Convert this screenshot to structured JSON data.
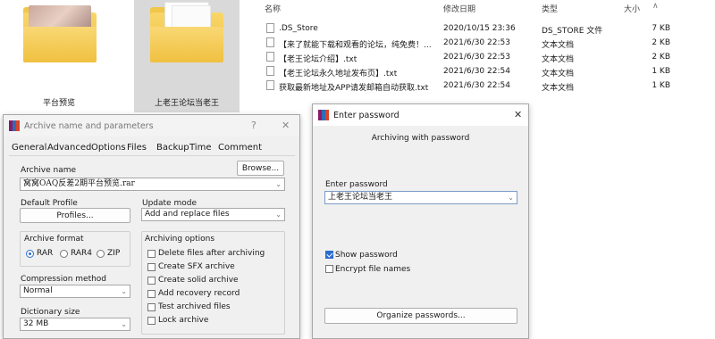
{
  "explorer": {
    "folders": [
      {
        "label": "平台预览"
      },
      {
        "label": "上老王论坛当老王"
      }
    ],
    "columns": {
      "name": "名称",
      "modified": "修改日期",
      "type": "类型",
      "size": "大小"
    },
    "files": [
      {
        "name": ".DS_Store",
        "modified": "2020/10/15 23:36",
        "type": "DS_STORE 文件",
        "size": "7 KB"
      },
      {
        "name": "【来了就能下载和观看的论坛，纯免费！...",
        "modified": "2021/6/30 22:53",
        "type": "文本文档",
        "size": "2 KB"
      },
      {
        "name": "【老王论坛介绍】.txt",
        "modified": "2021/6/30 22:53",
        "type": "文本文档",
        "size": "2 KB"
      },
      {
        "name": "【老王论坛永久地址发布页】.txt",
        "modified": "2021/6/30 22:54",
        "type": "文本文档",
        "size": "1 KB"
      },
      {
        "name": "获取最新地址及APP请发邮箱自动获取.txt",
        "modified": "2021/6/30 22:54",
        "type": "文本文档",
        "size": "1 KB"
      }
    ]
  },
  "archive_dialog": {
    "title": "Archive name and parameters",
    "help": "?",
    "close": "✕",
    "tabs": [
      "General",
      "Advanced",
      "Options",
      "Files",
      "Backup",
      "Time",
      "Comment"
    ],
    "archive_name_label": "Archive name",
    "browse_button": "Browse...",
    "archive_name_value": "窝窝OAQ反差2期平台预览.rar",
    "default_profile_label": "Default Profile",
    "profiles_button": "Profiles...",
    "update_mode_label": "Update mode",
    "update_mode_value": "Add and replace files",
    "archive_format_label": "Archive format",
    "formats": [
      "RAR",
      "RAR4",
      "ZIP"
    ],
    "compression_method_label": "Compression method",
    "compression_method_value": "Normal",
    "dictionary_size_label": "Dictionary size",
    "dictionary_size_value": "32 MB",
    "archiving_options_label": "Archiving options",
    "options": [
      "Delete files after archiving",
      "Create SFX archive",
      "Create solid archive",
      "Add recovery record",
      "Test archived files",
      "Lock archive"
    ]
  },
  "password_dialog": {
    "title": "Enter password",
    "close": "✕",
    "subtitle": "Archiving with password",
    "enter_password_label": "Enter password",
    "password_value": "上老王论坛当老王",
    "show_password_label": "Show password",
    "encrypt_names_label": "Encrypt file names",
    "organize_button": "Organize passwords..."
  }
}
